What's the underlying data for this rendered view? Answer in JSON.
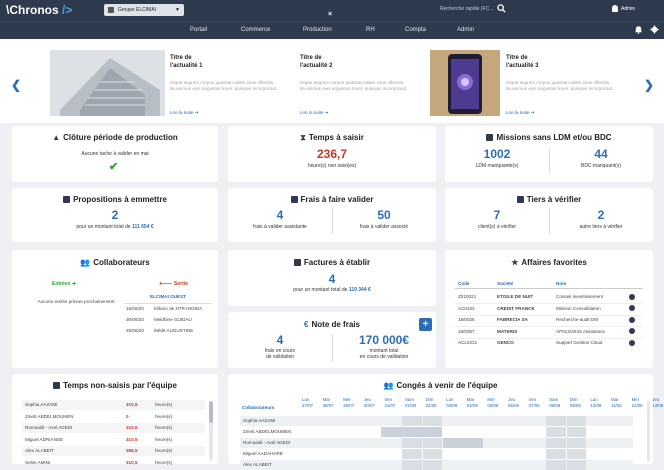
{
  "app": {
    "logo_prefix": "\\Chronos",
    "logo_suffix": "/>",
    "group_select": "Groupe ELCIMAI",
    "close": "×",
    "search_placeholder": "Recherche rapide (FC...",
    "user": "Admin"
  },
  "nav": {
    "items": [
      "Portail",
      "Commerce",
      "Production",
      "RH",
      "Compta",
      "Admin"
    ]
  },
  "news": [
    {
      "title_line1": "Titre de",
      "title_line2": "l'actualité 1",
      "text": "Utque aegrum corpus quassari etiam ictus offensis, ita animus eius angustus toner, quisquis incorporacit.",
      "link": "Lire la suite"
    },
    {
      "title_line1": "Titre de",
      "title_line2": "l'actualité 2",
      "text": "Utque aegrum corpus quassari etiam ictus offensis, ita animus eius angustus toner, quisquis incorporacit.",
      "link": "Lire la suite"
    },
    {
      "title_line1": "Titre de",
      "title_line2": "l'actualité 3",
      "text": "Utque aegrum corpus quassari etiam ictus offensis, ita animus eius angustus toner, quisquis incorporacit.",
      "link": "Lire la suite"
    }
  ],
  "cloture": {
    "title": "Clôture période de production",
    "message": "Aucune tache à valider en mai"
  },
  "temps": {
    "title": "Temps à saisir",
    "value": "236,7",
    "label": "heure(s) non saisi(es)"
  },
  "missions": {
    "title": "Missions sans LDM et/ou BDC",
    "ldm_value": "1002",
    "ldm_label": "LDM manquante(s)",
    "bdc_value": "44",
    "bdc_label": "BDC manquant(s)"
  },
  "propositions": {
    "title": "Propositions à emmettre",
    "value": "2",
    "label_prefix": "pour un montant total de",
    "amount": "111 654 €"
  },
  "frais": {
    "title": "Frais à faire valider",
    "left_value": "4",
    "left_label": "frais à valider assistante",
    "right_value": "50",
    "right_label": "frais à valider associé"
  },
  "tiers": {
    "title": "Tiers à vérifier",
    "left_value": "7",
    "left_label": "client(s) à vérifier",
    "right_value": "2",
    "right_label": "autre tiers à vérifier"
  },
  "collab": {
    "title": "Collaborateurs",
    "entrees": "Entrées",
    "sorties": "Sortie",
    "entrees_empty": "Aucune entrée prévue prochainement",
    "sortie_group": "ELCIMAI OUEST",
    "sorties_list": [
      {
        "date": "15/06/20",
        "name": "Killano de NTR HENDA"
      },
      {
        "date": "30/06/20",
        "name": "Meldhine GUIDAU"
      },
      {
        "date": "25/06/20",
        "name": "Médé AUGUSTINE"
      }
    ]
  },
  "factures": {
    "title": "Factures à établir",
    "value": "4",
    "label_prefix": "pour un montant total de",
    "amount": "119 344 €"
  },
  "notes": {
    "title": "Note de frais",
    "plus": "+",
    "left_value": "4",
    "left_label_1": "frais en cours",
    "left_label_2": "de validation",
    "right_value": "170 000€",
    "right_label_1": "montant total",
    "right_label_2": "en cours de validation"
  },
  "affaires": {
    "title": "Affaires favorites",
    "headers": [
      "Code",
      "Société",
      "Nom"
    ],
    "rows": [
      {
        "code": "Z010021",
        "societe": "ETOILE DE NUIT",
        "nom": "Conseil investissement"
      },
      {
        "code": "AC0103",
        "societe": "CREDIT FRANCE",
        "nom": "Mission Consolidation"
      },
      {
        "code": "18/0025",
        "societe": "FABRECIA SA",
        "nom": "Recherche-audit DM"
      },
      {
        "code": "18/0057",
        "societe": "MATERIS",
        "nom": "AP013/2K15 Assistance"
      },
      {
        "code": "ACL0231",
        "societe": "GENCO",
        "nom": "Support Gestion Cloud"
      }
    ]
  },
  "tempsnon": {
    "title": "Temps non-saisis par l'équipe",
    "rows": [
      {
        "name": "Sophia AAZAMI",
        "value": "310,5",
        "unit": "heure(s)"
      },
      {
        "name": "Zineb ABDELMOUMEN",
        "value": "0",
        "unit": "heure(s)"
      },
      {
        "name": "Romualdi - Axel ADEDI",
        "value": "310,5",
        "unit": "heure(s)"
      },
      {
        "name": "Miguel ADRIANSE",
        "value": "310,5",
        "unit": "heure(s)"
      },
      {
        "name": "Alex ALABEIT",
        "value": "286,5",
        "unit": "heure(s)"
      },
      {
        "name": "Selim AMINI",
        "value": "310,5",
        "unit": "heure(s)"
      }
    ]
  },
  "conges": {
    "title": "Congés à venir de l'équipe",
    "col_header": "Collaborateurs",
    "days": [
      {
        "d": "Lun",
        "n": "27/07"
      },
      {
        "d": "Mar",
        "n": "28/07"
      },
      {
        "d": "Mer",
        "n": "29/07"
      },
      {
        "d": "Jeu",
        "n": "30/07"
      },
      {
        "d": "Ven",
        "n": "31/07"
      },
      {
        "d": "Sam",
        "n": "01/08"
      },
      {
        "d": "Dim",
        "n": "02/08"
      },
      {
        "d": "Lun",
        "n": "03/08"
      },
      {
        "d": "Mar",
        "n": "04/08"
      },
      {
        "d": "Mer",
        "n": "05/08"
      },
      {
        "d": "Jeu",
        "n": "06/08"
      },
      {
        "d": "Ven",
        "n": "07/08"
      },
      {
        "d": "Sam",
        "n": "08/08"
      },
      {
        "d": "Dim",
        "n": "09/08"
      },
      {
        "d": "Lun",
        "n": "10/08"
      },
      {
        "d": "Mar",
        "n": "11/08"
      },
      {
        "d": "Mer",
        "n": "12/08"
      },
      {
        "d": "Jeu",
        "n": "13/08"
      },
      {
        "d": "Ven",
        "n": "14/08"
      }
    ],
    "people": [
      "Sophia AAZAMI",
      "Zineb ABDELMOUMEN",
      "Romualdi - Axel ADEDI",
      "Miguel AADAHARE",
      "Alex ALABEIT"
    ]
  },
  "colors": {
    "dark": "#2e3a4e",
    "accent": "#2d6db5",
    "red": "#c0392b",
    "green": "#2aa52a",
    "orange": "#e67e22"
  }
}
